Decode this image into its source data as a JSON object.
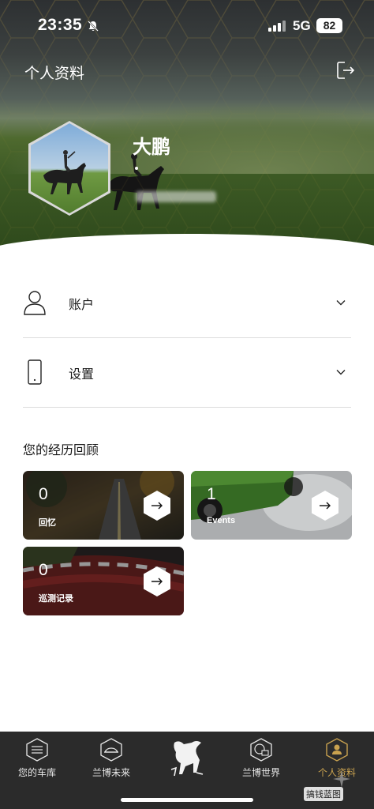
{
  "status_bar": {
    "time": "23:35",
    "network": "5G",
    "battery": "82"
  },
  "header": {
    "title": "个人资料"
  },
  "profile": {
    "name": "大鹏"
  },
  "menu": [
    {
      "label": "账户",
      "icon": "user-icon"
    },
    {
      "label": "设置",
      "icon": "phone-icon"
    }
  ],
  "experience": {
    "title": "您的经历回顾",
    "cards": [
      {
        "count": "0",
        "label": "回忆"
      },
      {
        "count": "1",
        "label": "Events"
      },
      {
        "count": "0",
        "label": "巡测记录"
      }
    ]
  },
  "tabs": [
    {
      "label": "您的车库",
      "icon": "garage-icon"
    },
    {
      "label": "兰博未来",
      "icon": "car-icon"
    },
    {
      "label": "",
      "icon": "lamborghini-bull-icon"
    },
    {
      "label": "兰博世界",
      "icon": "globe-icon"
    },
    {
      "label": "个人资料",
      "icon": "profile-icon"
    }
  ],
  "active_tab": "个人资料",
  "watermark": "搞钱蓝图",
  "colors": {
    "accent": "#c9a24f",
    "tab_bar": "#2b2b2b",
    "divider": "#dcdcdc"
  }
}
